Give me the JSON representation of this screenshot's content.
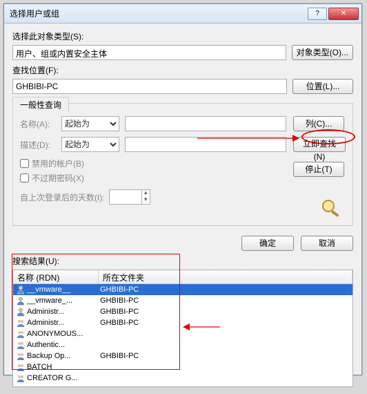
{
  "window": {
    "title": "选择用户或组"
  },
  "titlebar": {
    "help": "?",
    "close": "✕"
  },
  "section1": {
    "label": "选择此对象类型(S):",
    "value": "用户、组或内置安全主体",
    "button": "对象类型(O)..."
  },
  "section2": {
    "label": "查找位置(F):",
    "value": "GHBIBI-PC",
    "button": "位置(L)..."
  },
  "groupbox": {
    "legend": "一般性查询",
    "name_label": "名称(A):",
    "name_op": "起始为",
    "desc_label": "描述(D):",
    "desc_op": "起始为",
    "chk_disabled": "禁用的帐户(B)",
    "chk_neverexp": "不过期密码(X)",
    "days_label": "自上次登录后的天数(I):"
  },
  "side_buttons": {
    "columns": "列(C)...",
    "findnow": "立即查找(N)",
    "stop": "停止(T)"
  },
  "okrow": {
    "ok": "确定",
    "cancel": "取消"
  },
  "results": {
    "label": "搜索结果(U):",
    "col1": "名称 (RDN)",
    "col2": "所在文件夹",
    "rows": [
      {
        "icon": "user",
        "name": "__vmware__",
        "folder": "GHBIBI-PC",
        "sel": true
      },
      {
        "icon": "user",
        "name": "__vmware_...",
        "folder": "GHBIBI-PC"
      },
      {
        "icon": "user",
        "name": "Administr...",
        "folder": "GHBIBI-PC"
      },
      {
        "icon": "group",
        "name": "Administr...",
        "folder": "GHBIBI-PC"
      },
      {
        "icon": "group",
        "name": "ANONYMOUS...",
        "folder": ""
      },
      {
        "icon": "group",
        "name": "Authentic...",
        "folder": ""
      },
      {
        "icon": "group",
        "name": "Backup Op...",
        "folder": "GHBIBI-PC"
      },
      {
        "icon": "group",
        "name": "BATCH",
        "folder": ""
      },
      {
        "icon": "group",
        "name": "CREATOR G...",
        "folder": ""
      }
    ]
  }
}
